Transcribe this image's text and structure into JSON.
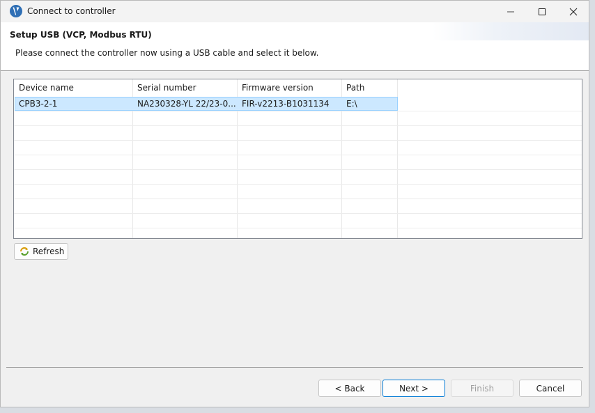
{
  "window": {
    "title": "Connect to controller"
  },
  "header": {
    "title": "Setup USB (VCP, Modbus RTU)",
    "description": "Please connect the controller now using a USB cable and select it below."
  },
  "table": {
    "columns": [
      "Device name",
      "Serial number",
      "Firmware version",
      "Path"
    ],
    "rows": [
      [
        "CPB3-2-1",
        "NA230328-YL 22/23-0...",
        "FIR-v2213-B1031134",
        "E:\\"
      ]
    ]
  },
  "refresh_label": "Refresh",
  "buttons": {
    "back": "< Back",
    "next": "Next >",
    "finish": "Finish",
    "cancel": "Cancel"
  },
  "colors": {
    "selection": "#cce8ff",
    "selection_border": "#99d1ff",
    "accent": "#0078d4"
  }
}
